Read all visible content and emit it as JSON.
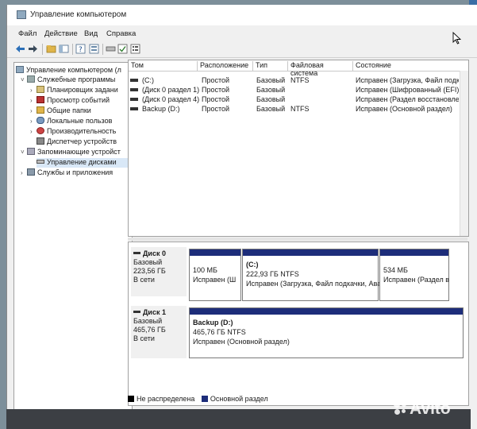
{
  "window": {
    "title": "Управление компьютером"
  },
  "menu": [
    "Файл",
    "Действие",
    "Вид",
    "Справка"
  ],
  "tree": {
    "root": "Управление компьютером (л",
    "items": [
      "Служебные программы",
      "Планировщик задани",
      "Просмотр событий",
      "Общие папки",
      "Локальные пользов",
      "Производительность",
      "Диспетчер устройств",
      "Запоминающие устройст",
      "Управление дисками",
      "Службы и приложения"
    ]
  },
  "volumes": {
    "columns": [
      "Том",
      "Расположение",
      "Тип",
      "Файловая система",
      "Состояние"
    ],
    "rows": [
      [
        "(C:)",
        "Простой",
        "Базовый",
        "NTFS",
        "Исправен (Загрузка, Файл подкачк"
      ],
      [
        "(Диск 0 раздел 1)",
        "Простой",
        "Базовый",
        "",
        "Исправен (Шифрованный (EFI) сист"
      ],
      [
        "(Диск 0 раздел 4)",
        "Простой",
        "Базовый",
        "",
        "Исправен (Раздел восстановления)"
      ],
      [
        "Backup (D:)",
        "Простой",
        "Базовый",
        "NTFS",
        "Исправен (Основной раздел)"
      ]
    ]
  },
  "disks": [
    {
      "name": "Диск 0",
      "type": "Базовый",
      "size": "223,56 ГБ",
      "status": "В сети",
      "partitions": [
        {
          "label": "",
          "size": "100 МБ",
          "status": "Исправен (Ш"
        },
        {
          "label": "(C:)",
          "size": "222,93 ГБ NTFS",
          "status": "Исправен (Загрузка, Файл подкачки, Ава"
        },
        {
          "label": "",
          "size": "534 МБ",
          "status": "Исправен (Раздел в"
        }
      ]
    },
    {
      "name": "Диск 1",
      "type": "Базовый",
      "size": "465,76 ГБ",
      "status": "В сети",
      "partitions": [
        {
          "label": "Backup  (D:)",
          "size": "465,76 ГБ NTFS",
          "status": "Исправен (Основной раздел)"
        }
      ]
    }
  ],
  "legend": {
    "unallocated": "Не распределена",
    "primary": "Основной раздел"
  },
  "colors": {
    "primary": "#1d2d7a",
    "unallocated": "#000000",
    "selected": "#d9e8f7"
  },
  "watermark": "Avito"
}
